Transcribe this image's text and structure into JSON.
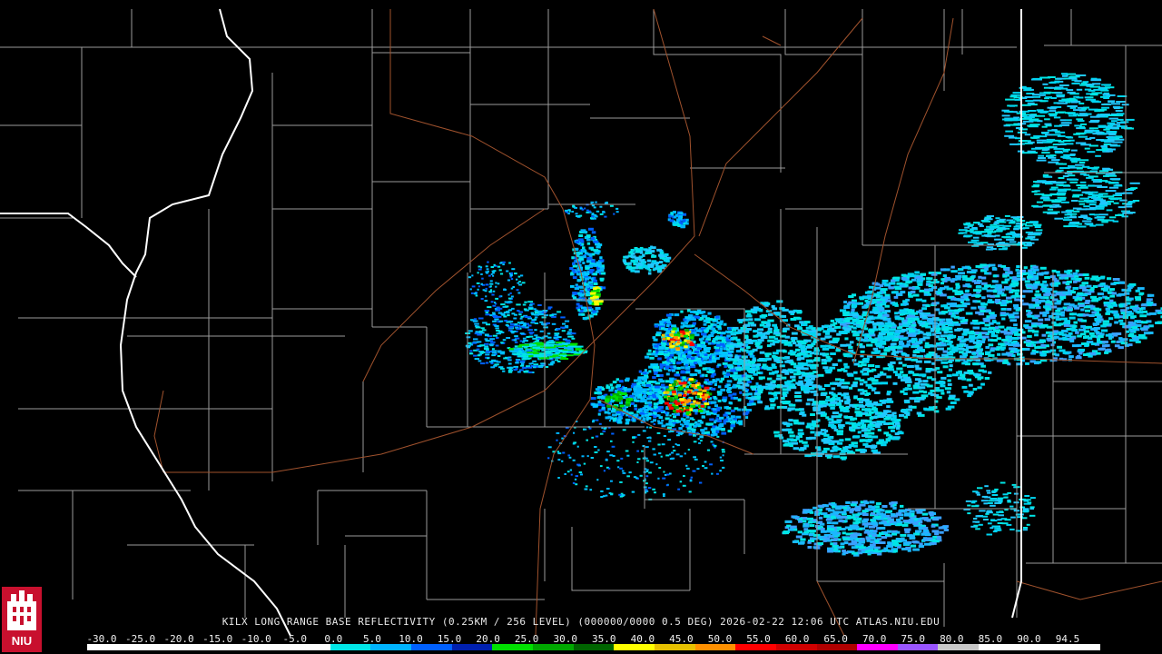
{
  "product": {
    "caption": "KILX LONG RANGE BASE REFLECTIVITY (0.25KM / 256 LEVEL) (000000/0000 0.5 DEG) 2026-02-22 12:06 UTC  ATLAS.NIU.EDU"
  },
  "logo": {
    "text": "NIU",
    "icon": "niu-castle-icon",
    "color": "#c8102e"
  },
  "colors": {
    "background": "#000000",
    "county_lines": "#9a9a9a",
    "state_lines": "#ffffff",
    "highways": "#a0522d"
  },
  "scale": {
    "labels": [
      "-30.0",
      "-25.0",
      "-20.0",
      "-15.0",
      "-10.0",
      "-5.0",
      "0.0",
      "5.0",
      "10.0",
      "15.0",
      "20.0",
      "25.0",
      "30.0",
      "35.0",
      "40.0",
      "45.0",
      "50.0",
      "55.0",
      "60.0",
      "65.0",
      "70.0",
      "75.0",
      "80.0",
      "85.0",
      "90.0",
      "94.5"
    ],
    "colors": [
      "#ffffff",
      "#ffffff",
      "#ffffff",
      "#ffffff",
      "#ffffff",
      "#ffffff",
      "#00e5e5",
      "#00b4ff",
      "#0060ff",
      "#0020b0",
      "#00e000",
      "#00a800",
      "#006400",
      "#ffff00",
      "#e6c000",
      "#ff9000",
      "#ff0000",
      "#d00000",
      "#b00000",
      "#ff00ff",
      "#9955ff",
      "#c8c8c8",
      "#ffffff",
      "#ffffff",
      "#ffffff"
    ]
  }
}
